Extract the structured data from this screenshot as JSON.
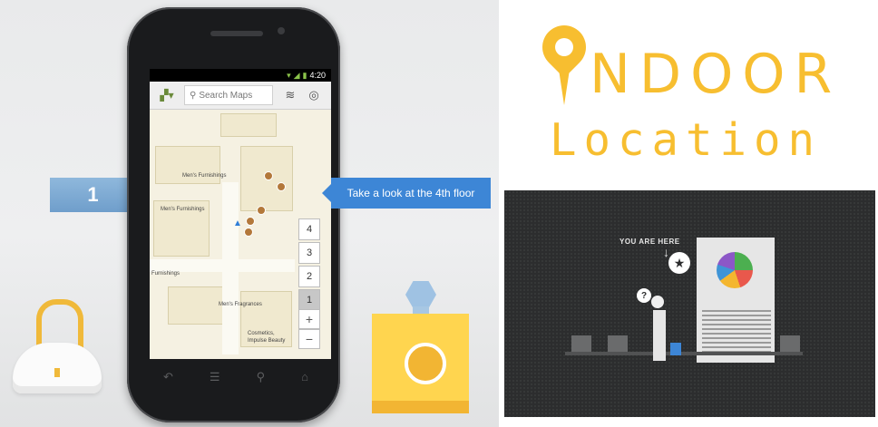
{
  "left_panel": {
    "floor_sign_label": "1",
    "phone": {
      "status_bar": {
        "time": "4:20"
      },
      "search_placeholder": "Search Maps",
      "map_labels": [
        "Men's Furnishings",
        "Men's Furnishings",
        "Furnishings",
        "Men's Fragrances",
        "Cosmetics,",
        "Impulse Beauty"
      ],
      "floor_picker": [
        "4",
        "3",
        "2",
        "1"
      ],
      "active_floor": "1",
      "zoom_in_label": "+",
      "zoom_out_label": "−"
    },
    "tooltip": "Take a look at the 4th floor"
  },
  "right_panel": {
    "title_line1": "NDOOR",
    "title_line2": "Location",
    "board_label": "YOU ARE HERE",
    "bubble_text": "?"
  },
  "colors": {
    "accent_yellow": "#f7be30",
    "tooltip_blue": "#3d86d6",
    "board_dark": "#2c2d2e"
  },
  "icons": [
    "map-layers-icon",
    "search-icon",
    "layers-icon",
    "compass-icon",
    "location-pin-icon",
    "you-are-here-star-icon"
  ]
}
